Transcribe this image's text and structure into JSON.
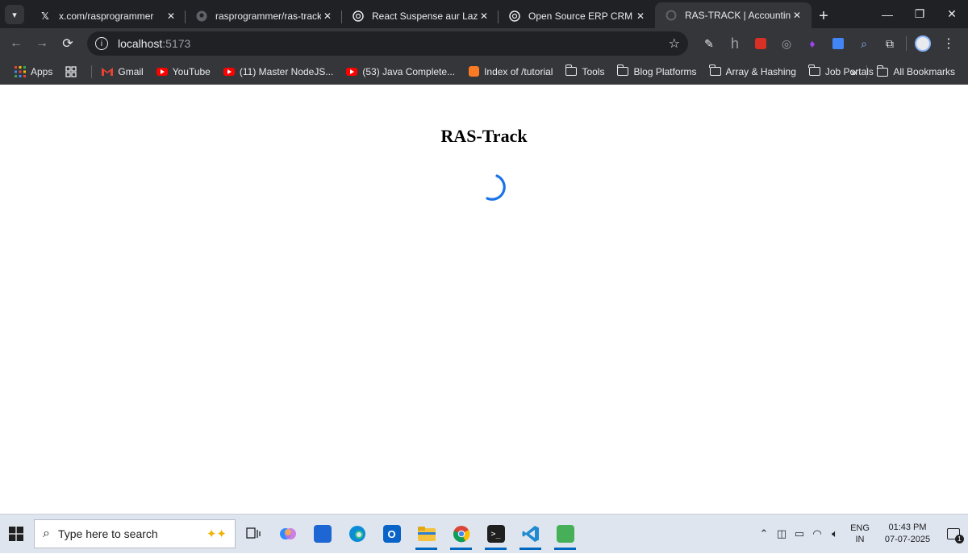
{
  "browser": {
    "tabs": [
      {
        "title": "x.com/rasprogrammer",
        "favicon": "x-logo-icon",
        "active": false
      },
      {
        "title": "rasprogrammer/ras-track",
        "favicon": "github-icon",
        "active": false
      },
      {
        "title": "React Suspense aur Lazy",
        "favicon": "chatgpt-icon",
        "active": false
      },
      {
        "title": "Open Source ERP CRM",
        "favicon": "chatgpt-icon",
        "active": false
      },
      {
        "title": "RAS-TRACK | Accounting Inv",
        "favicon": "loading-icon",
        "active": true
      }
    ],
    "tab_close_glyph": "✕",
    "new_tab_glyph": "+",
    "address": {
      "host": "localhost",
      "port": ":5173"
    },
    "bookmarks": [
      {
        "label": "Apps",
        "icon": "apps-grid-icon"
      },
      {
        "label": "Gmail",
        "icon": "gmail-icon"
      },
      {
        "label": "YouTube",
        "icon": "youtube-icon"
      },
      {
        "label": "(11) Master NodeJS...",
        "icon": "youtube-icon"
      },
      {
        "label": "(53) Java Complete...",
        "icon": "youtube-icon"
      },
      {
        "label": "Index of /tutorial",
        "icon": "xampp-icon"
      },
      {
        "label": "Tools",
        "icon": "folder-icon"
      },
      {
        "label": "Blog Platforms",
        "icon": "folder-icon"
      },
      {
        "label": "Array & Hashing",
        "icon": "folder-icon"
      },
      {
        "label": "Job Portals",
        "icon": "folder-icon"
      }
    ],
    "all_bookmarks_label": "All Bookmarks"
  },
  "page": {
    "heading": "RAS-Track",
    "spinner_color": "#1a73e8"
  },
  "taskbar": {
    "search_placeholder": "Type here to search",
    "language_line1": "ENG",
    "language_line2": "IN",
    "time": "01:43 PM",
    "date": "07-07-2025",
    "notification_count": "1"
  },
  "colors": {
    "tab_strip": "#202124",
    "toolbar": "#35363a",
    "taskbar": "#dfe5ef",
    "accent": "#0067c0"
  }
}
